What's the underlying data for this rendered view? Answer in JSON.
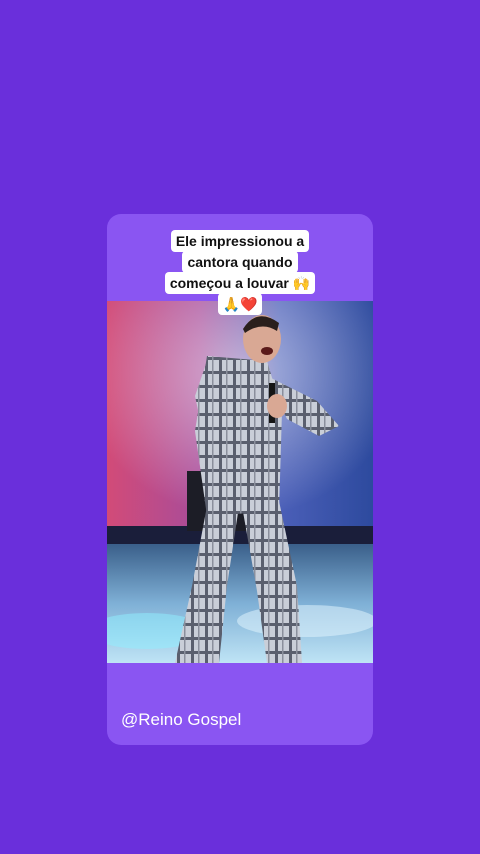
{
  "caption": {
    "lines": [
      "Ele impressionou a",
      "cantora quando",
      "começou a louvar 🙌",
      "🙏❤️"
    ]
  },
  "handle": "@Reino Gospel",
  "colors": {
    "background": "#6a2fdb",
    "card": "#8a55f2",
    "caption_bg": "#ffffff",
    "caption_text": "#111111",
    "handle_text": "#ffffff"
  }
}
